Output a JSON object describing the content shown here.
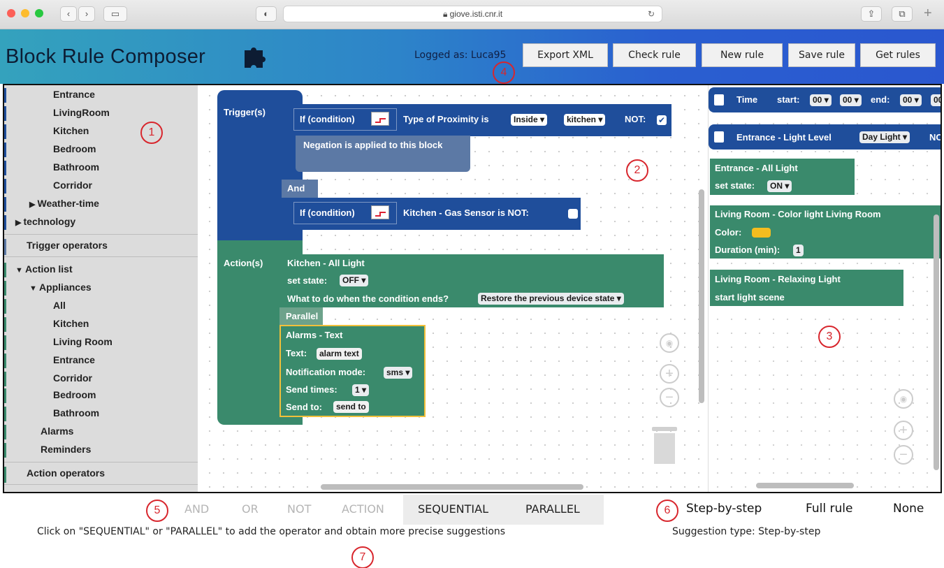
{
  "browser": {
    "url": "giove.isti.cnr.it"
  },
  "header": {
    "title": "Block Rule Composer",
    "logged_as": "Logged as: Luca95",
    "buttons": [
      "Export XML",
      "Check rule",
      "New rule",
      "Save rule",
      "Get rules"
    ]
  },
  "sidebar": {
    "items": [
      {
        "label": "Entrance",
        "level": 2,
        "color": "#1f4e9b"
      },
      {
        "label": "LivingRoom",
        "level": 2,
        "color": "#1f4e9b"
      },
      {
        "label": "Kitchen",
        "level": 2,
        "color": "#1f4e9b"
      },
      {
        "label": "Bedroom",
        "level": 2,
        "color": "#1f4e9b"
      },
      {
        "label": "Bathroom",
        "level": 2,
        "color": "#1f4e9b"
      },
      {
        "label": "Corridor",
        "level": 2,
        "color": "#1f4e9b"
      },
      {
        "label": "Weather-time",
        "level": 1,
        "arrow": "▶",
        "color": "#1f4e9b"
      },
      {
        "label": "technology",
        "level": 0,
        "arrow": "▶",
        "color": "#1f4e9b"
      },
      {
        "label": "Trigger operators",
        "level": 0,
        "color": "#5c79a5",
        "section": true
      },
      {
        "label": "Action list",
        "level": 0,
        "arrow": "▼",
        "color": "#3a8a6c"
      },
      {
        "label": "Appliances",
        "level": 1,
        "arrow": "▼",
        "color": "#3a8a6c"
      },
      {
        "label": "All",
        "level": 2,
        "color": "#3a8a6c"
      },
      {
        "label": "Kitchen",
        "level": 2,
        "color": "#3a8a6c"
      },
      {
        "label": "Living Room",
        "level": 2,
        "color": "#3a8a6c"
      },
      {
        "label": "Entrance",
        "level": 2,
        "color": "#3a8a6c"
      },
      {
        "label": "Corridor",
        "level": 2,
        "color": "#3a8a6c"
      },
      {
        "label": "Bedroom",
        "level": 2,
        "color": "#3a8a6c"
      },
      {
        "label": "Bathroom",
        "level": 2,
        "color": "#3a8a6c"
      },
      {
        "label": "Alarms",
        "level": 1,
        "color": "#3a8a6c"
      },
      {
        "label": "Reminders",
        "level": 1,
        "color": "#3a8a6c"
      },
      {
        "label": "Action operators",
        "level": 0,
        "color": "#3a8a6c",
        "section": true
      }
    ]
  },
  "workspace": {
    "trigger_label": "Trigger(s)",
    "action_label": "Action(s)",
    "cond1": {
      "if": "If (condition)",
      "text1": "Type of Proximity  is",
      "dd1": "Inside",
      "dd2": "kitchen",
      "not": "NOT:",
      "not_checked": true
    },
    "negation_text": "Negation is applied to this block",
    "and_label": "And",
    "cond2": {
      "if": "If (condition)",
      "text1": "Kitchen - Gas Sensor  is   NOT:",
      "not_checked": false
    },
    "action1": {
      "title": "Kitchen - All Light",
      "set_state": "set state:",
      "state": "OFF",
      "end_q": "What to do when the condition ends?",
      "end_value": "Restore the previous device state"
    },
    "parallel_label": "Parallel",
    "alarm": {
      "title": "Alarms - Text",
      "text_label": "Text:",
      "text_value": "alarm text",
      "mode_label": "Notification mode:",
      "mode_value": "sms",
      "times_label": "Send times:",
      "times_value": "1",
      "to_label": "Send to:",
      "to_value": "send to"
    }
  },
  "flyout": {
    "time": {
      "title": "Time",
      "start": "start:",
      "h1": "00",
      "m1": "00",
      "end": "end:",
      "h2": "00",
      "m2": "00"
    },
    "entrance_light": {
      "title": "Entrance - Light Level",
      "value": "Day Light",
      "trail": "NO"
    },
    "entrance_all": {
      "title": "Entrance - All Light",
      "set_state": "set state:",
      "state": "ON"
    },
    "living_color": {
      "title": "Living Room - Color light Living Room",
      "color_label": "Color:",
      "color": "#f5bd1f",
      "duration_label": "Duration (min):",
      "duration": "1"
    },
    "relaxing": {
      "title": "Living Room - Relaxing Light",
      "sub": "start light scene"
    }
  },
  "annotations": [
    "1",
    "2",
    "3",
    "4",
    "5",
    "6",
    "7"
  ],
  "bottom": {
    "operators": [
      {
        "label": "AND",
        "active": false
      },
      {
        "label": "OR",
        "active": false
      },
      {
        "label": "NOT",
        "active": false
      },
      {
        "label": "ACTION",
        "active": false
      },
      {
        "label": "SEQUENTIAL",
        "active": true
      },
      {
        "label": "PARALLEL",
        "active": true
      }
    ],
    "hint": "Click on \"SEQUENTIAL\" or \"PARALLEL\" to add the operator and obtain more precise suggestions",
    "suggestion_modes": [
      "Step-by-step",
      "Full rule",
      "None"
    ],
    "suggestion_type": "Suggestion type: Step-by-step"
  }
}
